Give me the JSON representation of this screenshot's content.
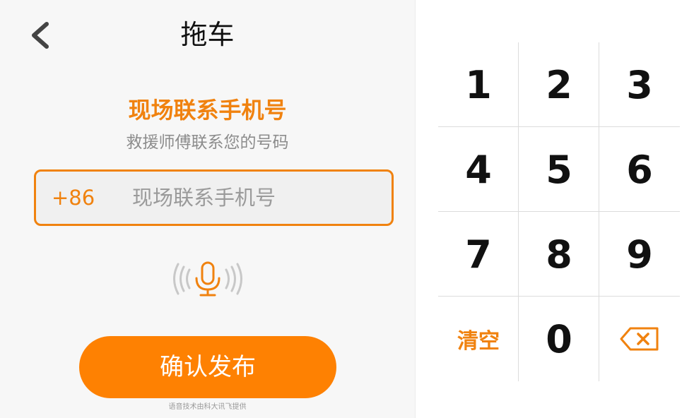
{
  "header": {
    "title": "拖车"
  },
  "form": {
    "section_title": "现场联系手机号",
    "section_subtitle": "救援师傅联系您的号码",
    "country_code": "+86",
    "phone_value": "",
    "phone_placeholder": "现场联系手机号"
  },
  "actions": {
    "confirm_label": "确认发布"
  },
  "footer": {
    "credit": "语音技术由科大讯飞提供"
  },
  "keypad": {
    "keys": [
      "1",
      "2",
      "3",
      "4",
      "5",
      "6",
      "7",
      "8",
      "9",
      "清空",
      "0"
    ],
    "backspace_icon": "backspace-icon"
  },
  "colors": {
    "accent": "#f0820f",
    "button": "#fe8102"
  }
}
